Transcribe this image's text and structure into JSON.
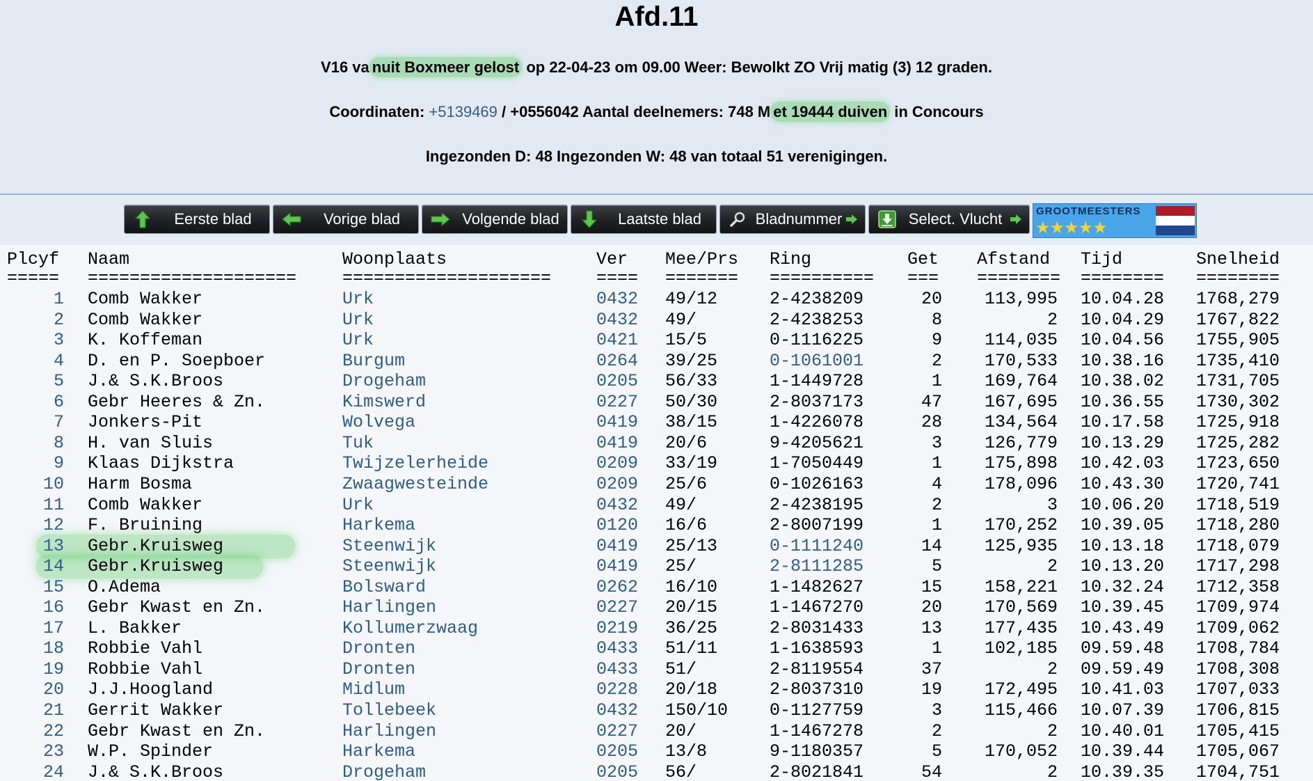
{
  "page": {
    "title": "Afd.11",
    "line1": {
      "pre": "V16 va",
      "hl": "nuit Boxmeer gelost",
      "post": " op 22-04-23 om 09.00 Weer: Bewolkt ZO Vrij matig (3) 12 graden."
    },
    "line2": {
      "pre": "Coordinaten: ",
      "coord_link": "+5139469",
      "mid": " / +0556042 Aantal deelnemers: 748 M",
      "hl": "et 19444 duiven",
      "post": " in Concours"
    },
    "line3": "Ingezonden D: 48 Ingezonden W: 48 van totaal 51 verenigingen."
  },
  "toolbar": {
    "buttons": [
      {
        "name": "eerste-blad-button",
        "label": "Eerste blad",
        "icon": "arrow-up-icon"
      },
      {
        "name": "vorige-blad-button",
        "label": "Vorige blad",
        "icon": "arrow-left-icon"
      },
      {
        "name": "volgende-blad-button",
        "label": "Volgende blad",
        "icon": "arrow-right-icon"
      },
      {
        "name": "laatste-blad-button",
        "label": "Laatste blad",
        "icon": "arrow-down-icon"
      },
      {
        "name": "bladnummer-button",
        "label": "Bladnummer",
        "icon": "magnifier-icon"
      },
      {
        "name": "select-vlucht-button",
        "label": "Select. Vlucht",
        "icon": "download-icon"
      }
    ],
    "logo": {
      "text": "GROOTMEESTERS",
      "stars": "★★★★★"
    }
  },
  "colors": {
    "link": "#2f5d8a",
    "highlight": "#78d282",
    "flag_red": "#ae1c28",
    "flag_white": "#ffffff",
    "flag_blue": "#21468b"
  },
  "table": {
    "headers": {
      "plc": "Plcyf",
      "naam": "Naam",
      "woon": "Woonplaats",
      "ver": "Ver",
      "mee": "Mee/Prs",
      "ring": "Ring",
      "get": "Get",
      "afs": "Afstand",
      "tijd": "Tijd",
      "snel": "Snelheid"
    },
    "separators": {
      "plc": "=====",
      "naam": "====================",
      "woon": "====================",
      "ver": "====",
      "mee": "=======",
      "ring": "==========",
      "get": "===",
      "afs": "========",
      "tijd": "========",
      "snel": "========"
    },
    "rows": [
      {
        "plc": "1",
        "naam": "Comb Wakker",
        "woon": "Urk",
        "ver": "0432",
        "mee": "49/12",
        "ring": "2-4238209",
        "get": "20",
        "afs": "113,995",
        "tijd": "10.04.28",
        "snel": "1768,279"
      },
      {
        "plc": "2",
        "naam": "Comb Wakker",
        "woon": "Urk",
        "ver": "0432",
        "mee": "49/",
        "ring": "2-4238253",
        "get": "8",
        "afs": "2",
        "tijd": "10.04.29",
        "snel": "1767,822"
      },
      {
        "plc": "3",
        "naam": "K. Koffeman",
        "woon": "Urk",
        "ver": "0421",
        "mee": "15/5",
        "ring": "0-1116225",
        "get": "9",
        "afs": "114,035",
        "tijd": "10.04.56",
        "snel": "1755,905"
      },
      {
        "plc": "4",
        "naam": "D. en P. Soepboer",
        "woon": "Burgum",
        "ver": "0264",
        "mee": "39/25",
        "ring": "0-1061001",
        "ring_link": true,
        "get": "2",
        "afs": "170,533",
        "tijd": "10.38.16",
        "snel": "1735,410"
      },
      {
        "plc": "5",
        "naam": "J.& S.K.Broos",
        "woon": "Drogeham",
        "ver": "0205",
        "mee": "56/33",
        "ring": "1-1449728",
        "get": "1",
        "afs": "169,764",
        "tijd": "10.38.02",
        "snel": "1731,705"
      },
      {
        "plc": "6",
        "naam": "Gebr Heeres & Zn.",
        "woon": "Kimswerd",
        "ver": "0227",
        "mee": "50/30",
        "ring": "2-8037173",
        "get": "47",
        "afs": "167,695",
        "tijd": "10.36.55",
        "snel": "1730,302"
      },
      {
        "plc": "7",
        "naam": "Jonkers-Pit",
        "woon": "Wolvega",
        "ver": "0419",
        "mee": "38/15",
        "ring": "1-4226078",
        "get": "28",
        "afs": "134,564",
        "tijd": "10.17.58",
        "snel": "1725,918"
      },
      {
        "plc": "8",
        "naam": "H. van Sluis",
        "woon": "Tuk",
        "ver": "0419",
        "mee": "20/6",
        "ring": "9-4205621",
        "get": "3",
        "afs": "126,779",
        "tijd": "10.13.29",
        "snel": "1725,282"
      },
      {
        "plc": "9",
        "naam": "Klaas Dijkstra",
        "woon": "Twijzelerheide",
        "ver": "0209",
        "mee": "33/19",
        "ring": "1-7050449",
        "get": "1",
        "afs": "175,898",
        "tijd": "10.42.03",
        "snel": "1723,650"
      },
      {
        "plc": "10",
        "naam": "Harm Bosma",
        "woon": "Zwaagwesteinde",
        "ver": "0209",
        "mee": "25/6",
        "ring": "0-1026163",
        "get": "4",
        "afs": "178,096",
        "tijd": "10.43.30",
        "snel": "1720,741"
      },
      {
        "plc": "11",
        "naam": "Comb Wakker",
        "woon": "Urk",
        "ver": "0432",
        "mee": "49/",
        "ring": "2-4238195",
        "get": "2",
        "afs": "3",
        "tijd": "10.06.20",
        "snel": "1718,519"
      },
      {
        "plc": "12",
        "naam": "F. Bruining",
        "woon": "Harkema",
        "ver": "0120",
        "mee": "16/6",
        "ring": "2-8007199",
        "get": "1",
        "afs": "170,252",
        "tijd": "10.39.05",
        "snel": "1718,280"
      },
      {
        "plc": "13",
        "naam": "Gebr.Kruisweg",
        "woon": "Steenwijk",
        "ver": "0419",
        "mee": "25/13",
        "ring": "0-1111240",
        "ring_link": true,
        "get": "14",
        "afs": "125,935",
        "tijd": "10.13.18",
        "snel": "1718,079",
        "highlight": true
      },
      {
        "plc": "14",
        "naam": "Gebr.Kruisweg",
        "woon": "Steenwijk",
        "ver": "0419",
        "mee": "25/",
        "ring": "2-8111285",
        "ring_link": true,
        "get": "5",
        "afs": "2",
        "tijd": "10.13.20",
        "snel": "1717,298",
        "highlight": true
      },
      {
        "plc": "15",
        "naam": "O.Adema",
        "woon": "Bolsward",
        "ver": "0262",
        "mee": "16/10",
        "ring": "1-1482627",
        "get": "15",
        "afs": "158,221",
        "tijd": "10.32.24",
        "snel": "1712,358"
      },
      {
        "plc": "16",
        "naam": "Gebr Kwast en Zn.",
        "woon": "Harlingen",
        "ver": "0227",
        "mee": "20/15",
        "ring": "1-1467270",
        "get": "20",
        "afs": "170,569",
        "tijd": "10.39.45",
        "snel": "1709,974"
      },
      {
        "plc": "17",
        "naam": "L. Bakker",
        "woon": "Kollumerzwaag",
        "ver": "0219",
        "mee": "36/25",
        "ring": "2-8031433",
        "get": "13",
        "afs": "177,435",
        "tijd": "10.43.49",
        "snel": "1709,062"
      },
      {
        "plc": "18",
        "naam": "Robbie Vahl",
        "woon": "Dronten",
        "ver": "0433",
        "mee": "51/11",
        "ring": "1-1638593",
        "get": "1",
        "afs": "102,185",
        "tijd": "09.59.48",
        "snel": "1708,784"
      },
      {
        "plc": "19",
        "naam": "Robbie Vahl",
        "woon": "Dronten",
        "ver": "0433",
        "mee": "51/",
        "ring": "2-8119554",
        "get": "37",
        "afs": "2",
        "tijd": "09.59.49",
        "snel": "1708,308"
      },
      {
        "plc": "20",
        "naam": "J.J.Hoogland",
        "woon": "Midlum",
        "ver": "0228",
        "mee": "20/18",
        "ring": "2-8037310",
        "get": "19",
        "afs": "172,495",
        "tijd": "10.41.03",
        "snel": "1707,033"
      },
      {
        "plc": "21",
        "naam": "Gerrit Wakker",
        "woon": "Tollebeek",
        "ver": "0432",
        "mee": "150/10",
        "ring": "0-1127759",
        "get": "3",
        "afs": "115,466",
        "tijd": "10.07.39",
        "snel": "1706,815"
      },
      {
        "plc": "22",
        "naam": "Gebr Kwast en Zn.",
        "woon": "Harlingen",
        "ver": "0227",
        "mee": "20/",
        "ring": "1-1467278",
        "get": "2",
        "afs": "2",
        "tijd": "10.40.01",
        "snel": "1705,415"
      },
      {
        "plc": "23",
        "naam": "W.P. Spinder",
        "woon": "Harkema",
        "ver": "0205",
        "mee": "13/8",
        "ring": "9-1180357",
        "get": "5",
        "afs": "170,052",
        "tijd": "10.39.44",
        "snel": "1705,067"
      },
      {
        "plc": "24",
        "naam": "J.& S.K.Broos",
        "woon": "Drogeham",
        "ver": "0205",
        "mee": "56/",
        "ring": "2-8021841",
        "get": "54",
        "afs": "2",
        "tijd": "10.39.35",
        "snel": "1704,751"
      }
    ]
  }
}
